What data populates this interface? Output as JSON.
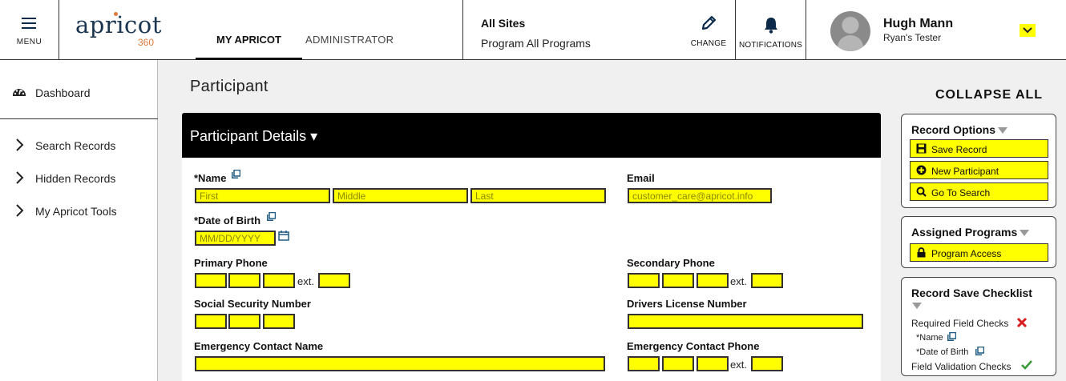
{
  "header": {
    "menu_label": "MENU",
    "logo_word": "apricot",
    "logo_num": "360",
    "tabs": [
      {
        "label": "MY APRICOT",
        "active": true
      },
      {
        "label": "ADMINISTRATOR",
        "active": false
      }
    ],
    "site_line1": "All Sites",
    "site_line2": "Program All Programs",
    "change_label": "CHANGE",
    "notifications_label": "NOTIFICATIONS",
    "user_name": "Hugh Mann",
    "user_role": "Ryan's Tester",
    "user_dropdown_icon": "chevron-down-icon"
  },
  "sidebar": {
    "items": [
      {
        "label": "Dashboard",
        "icon": "dashboard-icon"
      },
      {
        "label": "Search Records",
        "icon": "chevron-right-icon"
      },
      {
        "label": "Hidden Records",
        "icon": "chevron-right-icon"
      },
      {
        "label": "My Apricot Tools",
        "icon": "chevron-right-icon"
      }
    ]
  },
  "main": {
    "page_title": "Participant",
    "collapse_all": "COLLAPSE ALL",
    "section_title": "Participant Details ▾",
    "fields": {
      "name_label": "*Name",
      "name_first_placeholder": "First",
      "name_middle_placeholder": "Middle",
      "name_last_placeholder": "Last",
      "email_label": "Email",
      "email_placeholder": "customer_care@apricot.info",
      "dob_label": "*Date of Birth",
      "dob_placeholder": "MM/DD/YYYY",
      "primary_phone_label": "Primary Phone",
      "secondary_phone_label": "Secondary Phone",
      "ext_label": "ext.",
      "ssn_label": "Social Security Number",
      "dl_label": "Drivers License Number",
      "ec_name_label": "Emergency Contact Name",
      "ec_phone_label": "Emergency Contact Phone"
    }
  },
  "right_panel": {
    "record_options": {
      "title": "Record Options",
      "buttons": [
        {
          "label": "Save Record",
          "icon": "save-icon"
        },
        {
          "label": "New Participant",
          "icon": "plus-circle-icon"
        },
        {
          "label": "Go To Search",
          "icon": "search-icon"
        }
      ]
    },
    "assigned_programs": {
      "title": "Assigned Programs",
      "button": {
        "label": "Program Access",
        "icon": "lock-icon"
      }
    },
    "checklist": {
      "title": "Record Save Checklist",
      "required_label": "Required Field Checks",
      "required_items": [
        "*Name",
        "*Date of Birth"
      ],
      "validation_label": "Field Validation Checks"
    }
  },
  "colors": {
    "field_yellow": "#ffff00",
    "header_black": "#000000",
    "link_blue": "#1f5a82",
    "error_red": "#d81e1e",
    "ok_green": "#3a9a3a",
    "logo_orange": "#e07a3a"
  }
}
